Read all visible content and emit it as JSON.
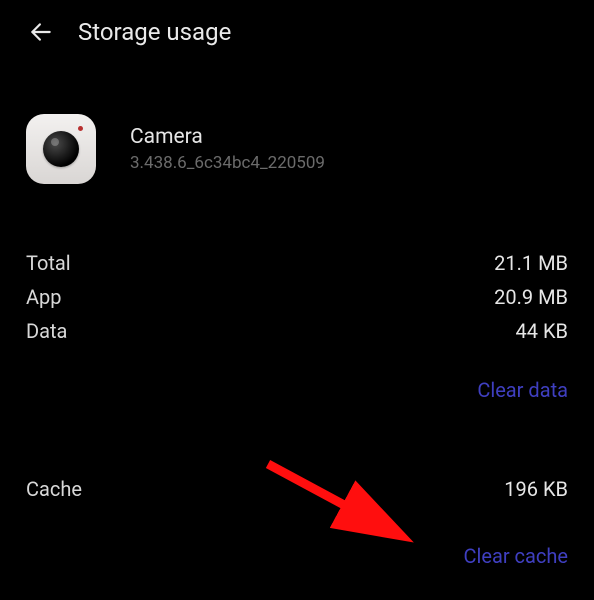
{
  "header": {
    "title": "Storage usage"
  },
  "app": {
    "name": "Camera",
    "version": "3.438.6_6c34bc4_220509"
  },
  "stats": {
    "total": {
      "label": "Total",
      "value": "21.1 MB"
    },
    "app": {
      "label": "App",
      "value": "20.9 MB"
    },
    "data": {
      "label": "Data",
      "value": "44 KB"
    },
    "cache": {
      "label": "Cache",
      "value": "196 KB"
    }
  },
  "actions": {
    "clear_data": "Clear data",
    "clear_cache": "Clear cache"
  },
  "colors": {
    "link": "#3f3fc0",
    "annotation": "#ff0000"
  }
}
